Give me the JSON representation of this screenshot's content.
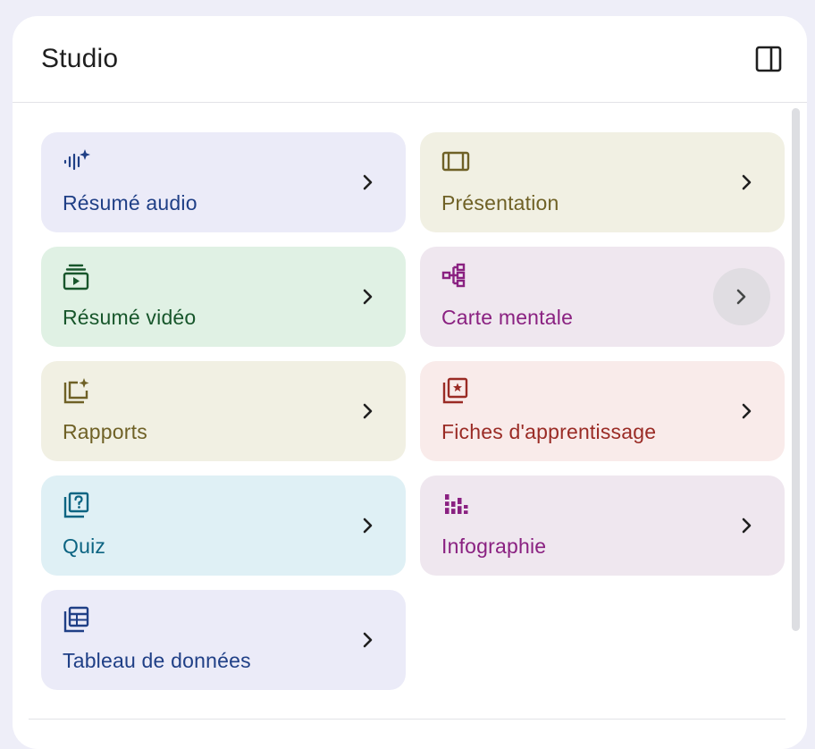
{
  "header": {
    "title": "Studio",
    "collapse_icon": "side-panel-icon"
  },
  "cards": [
    {
      "label": "Résumé audio",
      "icon": "audio-sparkle-icon",
      "bg": "#ebebf8",
      "color": "#1f3f86"
    },
    {
      "label": "Présentation",
      "icon": "slideshow-icon",
      "bg": "#f1f0e3",
      "color": "#6f6126"
    },
    {
      "label": "Résumé vidéo",
      "icon": "video-library-icon",
      "bg": "#e0f1e4",
      "color": "#17562b"
    },
    {
      "label": "Carte mentale",
      "icon": "mind-map-icon",
      "bg": "#efe7ef",
      "color": "#8a2181"
    },
    {
      "label": "Rapports",
      "icon": "reports-sparkle-icon",
      "bg": "#f1f0e3",
      "color": "#6f6126"
    },
    {
      "label": "Fiches d'apprentissage",
      "icon": "flashcards-icon",
      "bg": "#f9ebea",
      "color": "#9a2b25"
    },
    {
      "label": "Quiz",
      "icon": "quiz-icon",
      "bg": "#dff0f5",
      "color": "#0c6482"
    },
    {
      "label": "Infographie",
      "icon": "infographic-icon",
      "bg": "#efe7ef",
      "color": "#8a2181"
    },
    {
      "label": "Tableau de données",
      "icon": "data-table-icon",
      "bg": "#ebebf8",
      "color": "#1f3f86"
    }
  ],
  "chevron_icon": "chevron-right-icon"
}
